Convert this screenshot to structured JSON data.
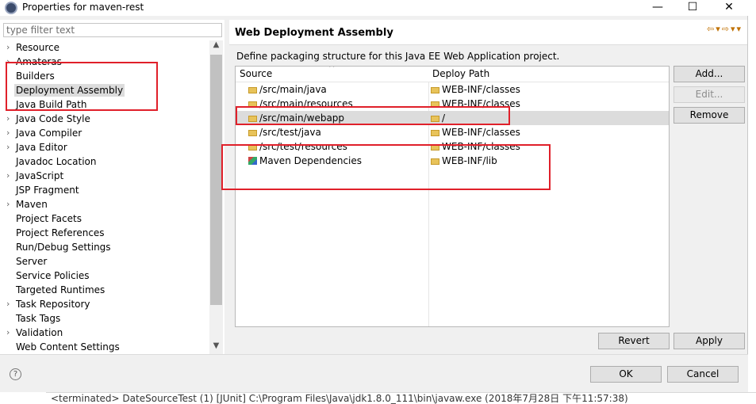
{
  "window": {
    "title": "Properties for maven-rest",
    "controls": {
      "minimize": "—",
      "maximize": "☐",
      "close": "✕"
    }
  },
  "filter": {
    "placeholder": "type filter text"
  },
  "tree": {
    "items": [
      {
        "label": "Resource",
        "expandable": true
      },
      {
        "label": "Amateras",
        "expandable": true
      },
      {
        "label": "Builders",
        "expandable": false
      },
      {
        "label": "Deployment Assembly",
        "expandable": false,
        "selected": true
      },
      {
        "label": "Java Build Path",
        "expandable": false
      },
      {
        "label": "Java Code Style",
        "expandable": true
      },
      {
        "label": "Java Compiler",
        "expandable": true
      },
      {
        "label": "Java Editor",
        "expandable": true
      },
      {
        "label": "Javadoc Location",
        "expandable": false
      },
      {
        "label": "JavaScript",
        "expandable": true
      },
      {
        "label": "JSP Fragment",
        "expandable": false
      },
      {
        "label": "Maven",
        "expandable": true
      },
      {
        "label": "Project Facets",
        "expandable": false
      },
      {
        "label": "Project References",
        "expandable": false
      },
      {
        "label": "Run/Debug Settings",
        "expandable": false
      },
      {
        "label": "Server",
        "expandable": false
      },
      {
        "label": "Service Policies",
        "expandable": false
      },
      {
        "label": "Targeted Runtimes",
        "expandable": false
      },
      {
        "label": "Task Repository",
        "expandable": true
      },
      {
        "label": "Task Tags",
        "expandable": false
      },
      {
        "label": "Validation",
        "expandable": true
      },
      {
        "label": "Web Content Settings",
        "expandable": false
      }
    ]
  },
  "page": {
    "title": "Web Deployment Assembly",
    "description": "Define packaging structure for this Java EE Web Application project.",
    "columns": {
      "source": "Source",
      "deploy": "Deploy Path"
    },
    "rows": [
      {
        "source": "/src/main/java",
        "deploy": "WEB-INF/classes",
        "icon": "folder-icon"
      },
      {
        "source": "/src/main/resources",
        "deploy": "WEB-INF/classes",
        "icon": "folder-icon"
      },
      {
        "source": "/src/main/webapp",
        "deploy": "/",
        "icon": "folder-icon",
        "selected": true
      },
      {
        "source": "/src/test/java",
        "deploy": "WEB-INF/classes",
        "icon": "folder-icon"
      },
      {
        "source": "/src/test/resources",
        "deploy": "WEB-INF/classes",
        "icon": "folder-icon"
      },
      {
        "source": "Maven Dependencies",
        "deploy": "WEB-INF/lib",
        "icon": "library-icon"
      }
    ],
    "buttons": {
      "add": "Add...",
      "edit": "Edit...",
      "remove": "Remove",
      "revert": "Revert",
      "apply": "Apply"
    }
  },
  "footer": {
    "help": "?",
    "ok": "OK",
    "cancel": "Cancel"
  },
  "console": {
    "text": "<terminated> DateSourceTest (1) [JUnit] C:\\Program Files\\Java\\jdk1.8.0_111\\bin\\javaw.exe (2018年7月28日 下午11:57:38)"
  },
  "colors": {
    "highlight": "#e0202a",
    "selection": "#dcdcdc",
    "folder": "#e8c35a",
    "default_button_border": "#0078d7"
  }
}
